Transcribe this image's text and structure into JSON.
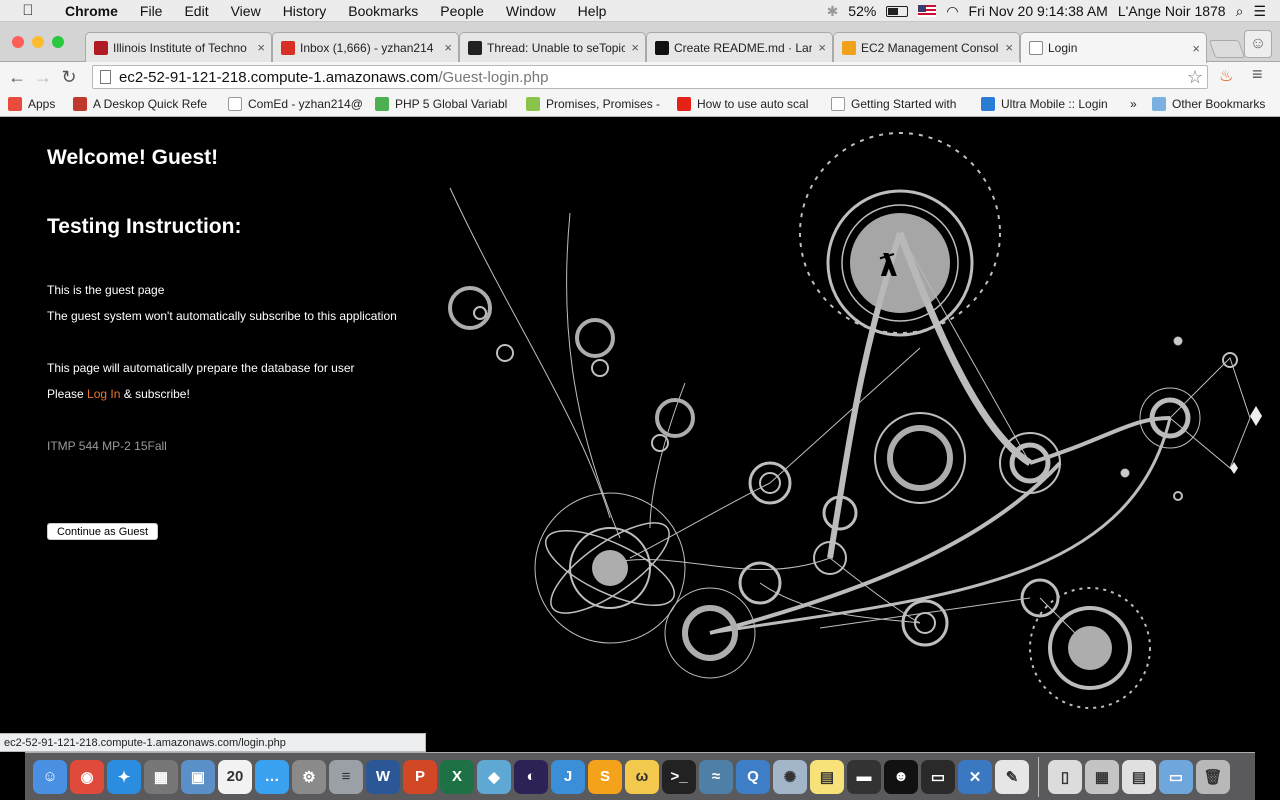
{
  "menubar": {
    "app_name": "Chrome",
    "items": [
      "File",
      "Edit",
      "View",
      "History",
      "Bookmarks",
      "People",
      "Window",
      "Help"
    ],
    "battery": "52%",
    "battery_level": 0.52,
    "datetime": "Fri Nov 20  9:14:38 AM",
    "user": "L'Ange Noir 1878"
  },
  "tabs": [
    {
      "title": "Illinois Institute of Techno",
      "favicon": "iit-icon",
      "color": "#b01c22"
    },
    {
      "title": "Inbox (1,666) - yzhan214",
      "favicon": "gmail-icon",
      "color": "#d93025"
    },
    {
      "title": "Thread: Unable to seTopic",
      "favicon": "blackboard-icon",
      "color": "#222222"
    },
    {
      "title": "Create README.md · Lang",
      "favicon": "github-icon",
      "color": "#111111"
    },
    {
      "title": "EC2 Management Consol",
      "favicon": "aws-icon",
      "color": "#f0a21a"
    },
    {
      "title": "Login",
      "favicon": "page-icon",
      "color": "#ffffff"
    }
  ],
  "address": {
    "host": "ec2-52-91-121-218.compute-1.amazonaws.com",
    "path": "/Guest-login.php"
  },
  "bookmarks": [
    {
      "label": "Apps",
      "icon": "apps-grid-icon",
      "color": "#e74c3c"
    },
    {
      "label": "A Deskop Quick Refe",
      "icon": "bug-icon",
      "color": "#c0392b"
    },
    {
      "label": "ComEd - yzhan214@",
      "icon": "page-icon",
      "color": "#ffffff"
    },
    {
      "label": "PHP 5 Global Variabl",
      "icon": "w3-icon",
      "color": "#4caf50"
    },
    {
      "label": "Promises, Promises -",
      "icon": "promises-icon",
      "color": "#8bc34a"
    },
    {
      "label": "How to use auto scal",
      "icon": "youtube-icon",
      "color": "#e62117"
    },
    {
      "label": "Getting Started with",
      "icon": "page-icon",
      "color": "#ffffff"
    },
    {
      "label": "Ultra Mobile :: Login",
      "icon": "ultra-icon",
      "color": "#2a7bd6"
    }
  ],
  "bookmarks_overflow": "»",
  "other_bookmarks": "Other Bookmarks",
  "page": {
    "welcome": "Welcome! Guest!",
    "heading": "Testing Instruction:",
    "line1": "This is the guest page",
    "line2": "The guest system won't automatically subscribe to this application",
    "line3": "This page will automatically prepare the database for user",
    "please": "Please",
    "login_link": "Log In",
    "subscribe": "& subscribe!",
    "course": "ITMP 544 MP-2 15Fall",
    "button": "Continue as Guest"
  },
  "status_url": "ec2-52-91-121-218.compute-1.amazonaws.com/login.php",
  "dock": [
    {
      "name": "finder-icon",
      "glyph": "☺",
      "color": "#4a90e2"
    },
    {
      "name": "chrome-icon",
      "glyph": "◉",
      "color": "#e04a3a"
    },
    {
      "name": "safari-icon",
      "glyph": "✦",
      "color": "#2b8de0"
    },
    {
      "name": "calculator-icon",
      "glyph": "▦",
      "color": "#777777"
    },
    {
      "name": "preview-icon",
      "glyph": "▣",
      "color": "#5b8fc7"
    },
    {
      "name": "calendar-icon",
      "glyph": "20",
      "color": "#f2f2f2"
    },
    {
      "name": "messages-icon",
      "glyph": "…",
      "color": "#3aa0f0"
    },
    {
      "name": "system-preferences-icon",
      "glyph": "⚙",
      "color": "#8a8a8a"
    },
    {
      "name": "database-icon",
      "glyph": "≡",
      "color": "#9aa0a6"
    },
    {
      "name": "word-icon",
      "glyph": "W",
      "color": "#2b5797"
    },
    {
      "name": "powerpoint-icon",
      "glyph": "P",
      "color": "#d24726"
    },
    {
      "name": "excel-icon",
      "glyph": "X",
      "color": "#1e7145"
    },
    {
      "name": "virtualbox-icon",
      "glyph": "◆",
      "color": "#5fa8d3"
    },
    {
      "name": "eclipse-icon",
      "glyph": "◐",
      "color": "#2c2255"
    },
    {
      "name": "intellij-icon",
      "glyph": "J",
      "color": "#3a8fd8"
    },
    {
      "name": "sublime-icon",
      "glyph": "S",
      "color": "#f4a21a"
    },
    {
      "name": "ftp-client-icon",
      "glyph": "ω",
      "color": "#f2c94c"
    },
    {
      "name": "terminal-icon",
      "glyph": ">_",
      "color": "#222222"
    },
    {
      "name": "mysql-workbench-icon",
      "glyph": "≈",
      "color": "#4e7fa6"
    },
    {
      "name": "quicktime-icon",
      "glyph": "Q",
      "color": "#3d7ec7"
    },
    {
      "name": "utility-icon",
      "glyph": "✺",
      "color": "#a3b6c9"
    },
    {
      "name": "stickies-icon",
      "glyph": "▤",
      "color": "#f7e27a"
    },
    {
      "name": "scanner-icon",
      "glyph": "▬",
      "color": "#333333"
    },
    {
      "name": "qq-icon",
      "glyph": "☻",
      "color": "#111111"
    },
    {
      "name": "console-icon",
      "glyph": "▭",
      "color": "#2a2a2a"
    },
    {
      "name": "xcode-icon",
      "glyph": "✕",
      "color": "#3a78c2"
    },
    {
      "name": "textedit-icon",
      "glyph": "✎",
      "color": "#e6e6e6"
    },
    {
      "name": "shell-document-icon",
      "glyph": "▯",
      "color": "#dcdcdc"
    },
    {
      "name": "screenshot-icon",
      "glyph": "▦",
      "color": "#c4c4c4"
    },
    {
      "name": "file-stack-icon",
      "glyph": "▤",
      "color": "#e0e0e0"
    },
    {
      "name": "folder-icon",
      "glyph": "▭",
      "color": "#6fa6dc"
    },
    {
      "name": "trash-icon",
      "glyph": "🗑",
      "color": "#b8b8b8"
    }
  ]
}
